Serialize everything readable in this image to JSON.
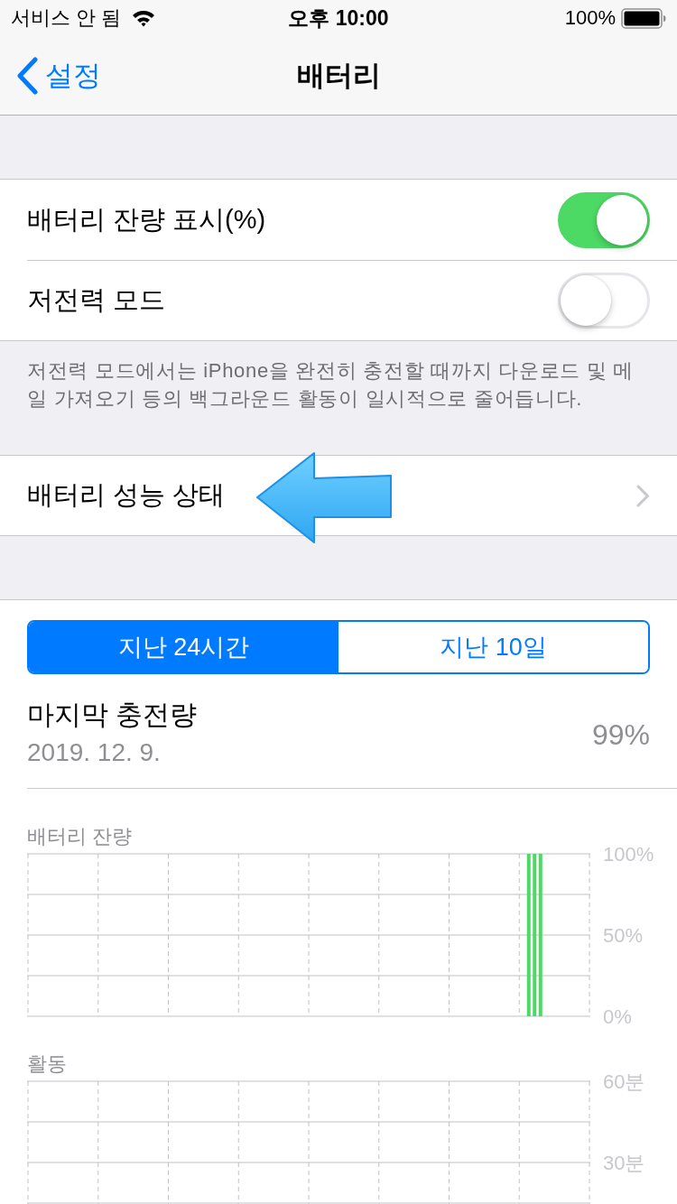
{
  "status_bar": {
    "carrier": "서비스 안 됨",
    "time": "오후 10:00",
    "battery": "100%"
  },
  "nav_bar": {
    "back": "설정",
    "title": "배터리"
  },
  "groups": [
    {
      "rows": [
        {
          "kind": "toggle",
          "label": "배터리 잔량 표시(%)",
          "on": true
        },
        {
          "kind": "toggle",
          "label": "저전력 모드",
          "on": false
        }
      ],
      "footer": "저전력 모드에서는 iPhone을 완전히 충전할 때까지 다운로드 및 메일 가져오기 등의 백그라운드 활동이 일시적으로 줄어듭니다."
    },
    {
      "rows": [
        {
          "kind": "link",
          "label": "배터리 성능 상태"
        }
      ]
    }
  ],
  "period_tabs": [
    {
      "label": "지난 24시간",
      "selected": true
    },
    {
      "label": "지난 10일",
      "selected": false
    }
  ],
  "last_charge": {
    "label": "마지막 충전량",
    "date": "2019. 12. 9.",
    "value": "99%"
  },
  "battery_chart": {
    "chart_data": {
      "type": "bar",
      "title": "배터리 잔량",
      "values": [
        null,
        null,
        null,
        null,
        null,
        null,
        null,
        null,
        null,
        null,
        null,
        null,
        null,
        null,
        null,
        null,
        null,
        null,
        null,
        null,
        null,
        null,
        null,
        null,
        null,
        null,
        null,
        null,
        null,
        null,
        null,
        null,
        null,
        null,
        null,
        null,
        null,
        null,
        null,
        null,
        null,
        null,
        null,
        null,
        null,
        null,
        null,
        null,
        null,
        null,
        null,
        null,
        null,
        null,
        null,
        null,
        null,
        null,
        null,
        null,
        null,
        null,
        null,
        null,
        null,
        null,
        null,
        null,
        null,
        null,
        null,
        null,
        null,
        null,
        null,
        null,
        null,
        null,
        null,
        null,
        null,
        null,
        null,
        null,
        null,
        100,
        100,
        100,
        null,
        null,
        null,
        null,
        null,
        null,
        null,
        null
      ],
      "ylim": [
        0,
        100
      ],
      "yticks": [
        {
          "value": 0,
          "label": "0%"
        },
        {
          "value": 50,
          "label": "50%"
        },
        {
          "value": 100,
          "label": "100%"
        }
      ]
    }
  },
  "activity_chart": {
    "title": "활동",
    "y_labels": [
      "60분",
      "30분"
    ]
  }
}
